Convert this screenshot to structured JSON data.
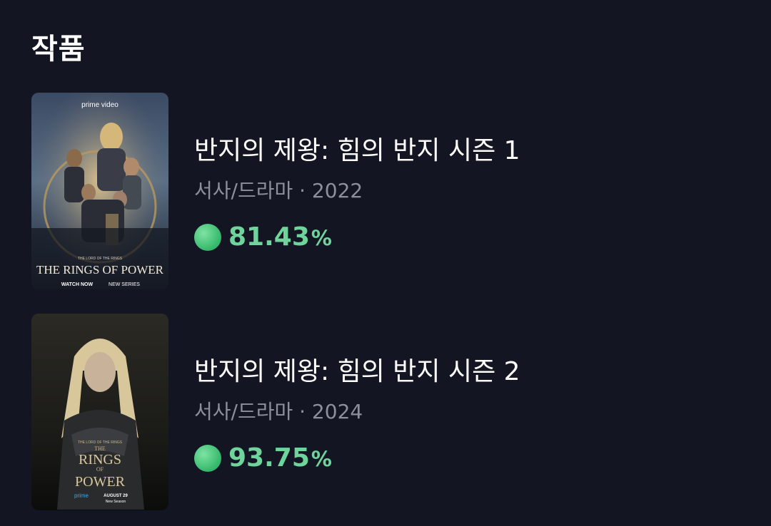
{
  "section": {
    "title": "작품"
  },
  "items": [
    {
      "title": "반지의 제왕: 힘의 반지 시즌 1",
      "meta": "서사/드라마 · 2022",
      "score_value": "81.43",
      "score_unit": "%",
      "score_color": "#6fd49b",
      "poster": {
        "brand": "prime video",
        "kicker": "THE LORD OF THE RINGS",
        "logo": "THE RINGS OF POWER",
        "footer_left": "WATCH NOW",
        "footer_right": "NEW SERIES"
      }
    },
    {
      "title": "반지의 제왕: 힘의 반지 시즌 2",
      "meta": "서사/드라마 · 2024",
      "score_value": "93.75",
      "score_unit": "%",
      "score_color": "#6fd49b",
      "poster": {
        "kicker": "THE LORD OF THE RINGS",
        "logo_line1": "THE",
        "logo_line2": "RINGS",
        "logo_line3": "OF",
        "logo_line4": "POWER",
        "brand": "prime",
        "date": "AUGUST 29",
        "date_sub": "New Season"
      }
    }
  ],
  "colors": {
    "background": "#131522",
    "accent_green": "#6fd49b",
    "muted": "#8d909c"
  }
}
